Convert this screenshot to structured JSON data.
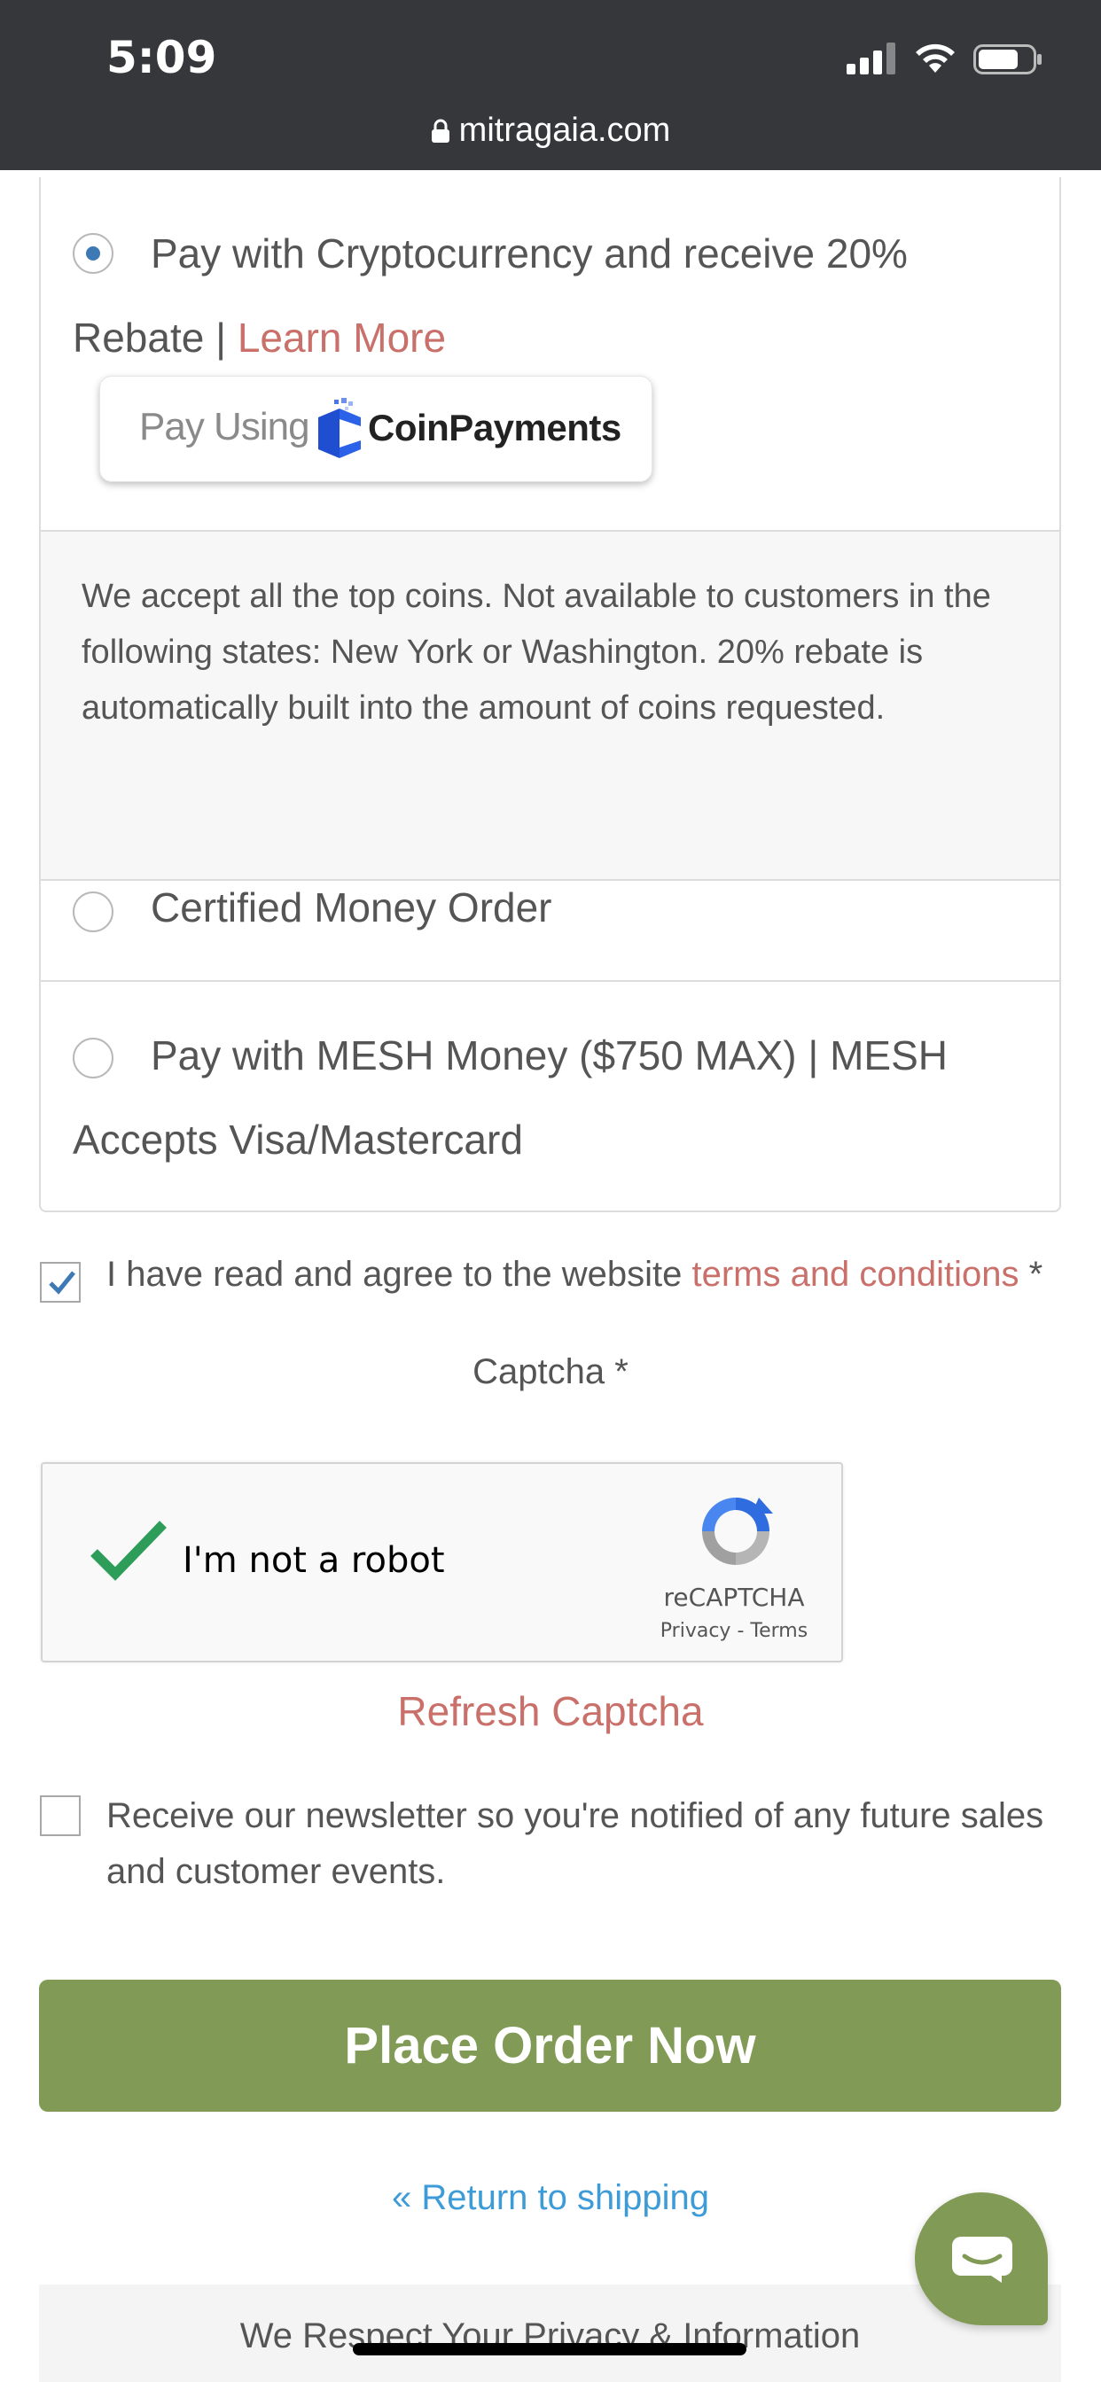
{
  "status_bar": {
    "time": "5:09",
    "url": "mitragaia.com"
  },
  "payment": {
    "crypto": {
      "selected": true,
      "label_line1": "Pay with Cryptocurrency and receive 20%",
      "label_line2_prefix": "Rebate | ",
      "learn_more": "Learn More",
      "badge_prefix": "Pay Using",
      "badge_brand": "CoinPayments",
      "description": "We accept all the top coins. Not available to customers in the following states: New York or Washington. 20% rebate is automatically built into the amount of coins requested."
    },
    "money_order": {
      "selected": false,
      "label": "Certified Money Order"
    },
    "mesh": {
      "selected": false,
      "label_line1": "Pay with MESH Money ($750 MAX) | MESH",
      "label_line2": "Accepts Visa/Mastercard"
    }
  },
  "terms": {
    "checked": true,
    "prefix": "I have read and agree to the website ",
    "link": "terms and conditions",
    "required_mark": " *"
  },
  "captcha": {
    "title": "Captcha *",
    "checkbox_label": "I'm not a robot",
    "brand": "reCAPTCHA",
    "privacy": "Privacy",
    "separator": " - ",
    "terms": "Terms",
    "refresh": "Refresh Captcha"
  },
  "newsletter": {
    "checked": false,
    "label": "Receive our newsletter so you're notified of any future sales and customer events."
  },
  "actions": {
    "place_order": "Place Order Now",
    "return_link": "« Return to shipping"
  },
  "footer": {
    "text": "We Respect Your Privacy & Information"
  },
  "colors": {
    "accent_link": "#c9706b",
    "button_green": "#819a55",
    "link_blue": "#3d9bd8",
    "radio_selected": "#3d7ab5"
  }
}
